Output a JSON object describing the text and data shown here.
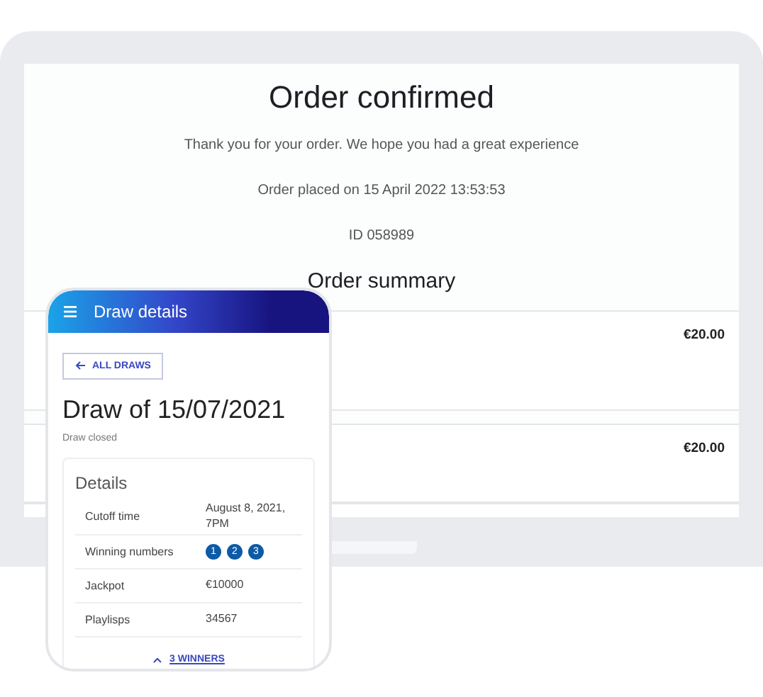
{
  "laptop": {
    "title": "Order confirmed",
    "message": "Thank you for your order. We hope you had a great experience",
    "placed": "Order placed on 15 April 2022 13:53:53",
    "order_id": "ID 058989",
    "summary_title": "Order summary",
    "items": [
      {
        "price": "€20.00"
      },
      {
        "price": "€20.00"
      }
    ]
  },
  "phone": {
    "header_title": "Draw details",
    "back_button": "ALL DRAWS",
    "draw_title": "Draw of 15/07/2021",
    "status": "Draw closed",
    "details": {
      "title": "Details",
      "rows": [
        {
          "kind": "text",
          "label": "Cutoff time",
          "value": "August 8, 2021, 7PM"
        },
        {
          "kind": "balls",
          "label": "Winning numbers",
          "numbers": [
            "1",
            "2",
            "3"
          ]
        },
        {
          "kind": "text",
          "label": "Jackpot",
          "value": "€10000"
        },
        {
          "kind": "text",
          "label": "Playlisps",
          "value": "34567"
        }
      ]
    },
    "winners_toggle": "3 WINNERS"
  }
}
